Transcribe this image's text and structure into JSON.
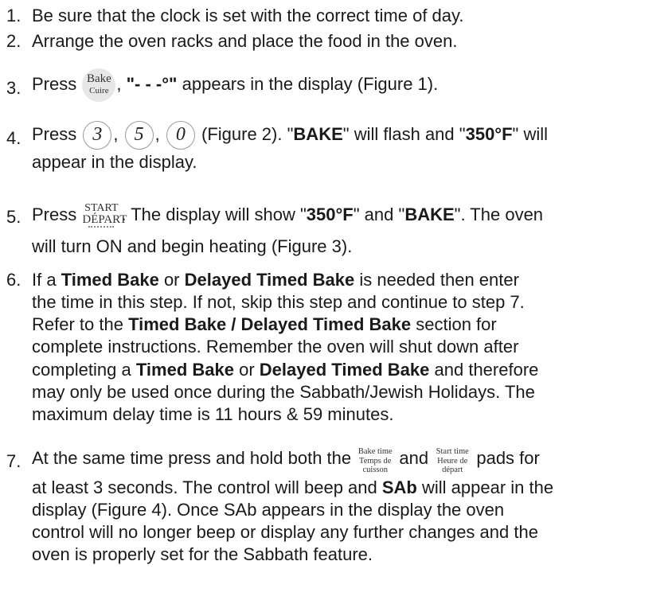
{
  "steps": [
    {
      "num": "1.",
      "text": "Be sure that the clock is set with the correct time of day."
    },
    {
      "num": "2.",
      "text": "Arrange the oven racks and place the food in the oven."
    },
    {
      "num": "3.",
      "press": "Press",
      "pad_top": "Bake",
      "pad_bottom": "Cuire",
      "comma": ",",
      "display_text": "\"- - -°\"",
      "rest": "appears in the display (Figure 1)."
    },
    {
      "num": "4.",
      "press": "Press",
      "digits": [
        "3",
        "5",
        "0"
      ],
      "comma": ",",
      "after_digits": "(Figure 2).",
      "q1": "\"",
      "bake_word": "BAKE",
      "q2": "\"",
      "flash_text": "will flash and",
      "q3": "\"",
      "temp": "350°F",
      "q4": "\"",
      "will": "will",
      "line2": "appear in the display."
    },
    {
      "num": "5.",
      "press": "Press",
      "pad_top": "START",
      "pad_bottom": "DÉPART",
      "display_text": ". The display will show",
      "q1": "\"",
      "temp": "350°F",
      "q2": "\"",
      "and_text": "and",
      "q3": "\"",
      "bake_word": "BAKE",
      "q4": "\"",
      "rest": ". The oven",
      "line2": "will turn ON and begin heating (Figure 3)."
    },
    {
      "num": "6.",
      "l1a": "If a",
      "l1b": "Timed Bake",
      "l1c": "or",
      "l1d": "Delayed Timed Bake",
      "l1e": "is needed then enter",
      "l2": "the time in this step. If not, skip this step and continue to step 7.",
      "l3a": "Refer to the",
      "l3b": "Timed Bake / Delayed Timed Bake",
      "l3c": "section for",
      "l4": "complete instructions. Remember the oven will shut down after",
      "l5a": "completing a",
      "l5b": "Timed Bake",
      "l5c": "or",
      "l5d": "Delayed Timed Bake",
      "l5e": "and therefore",
      "l6": "may only be used once during the Sabbath/Jewish Holidays. The",
      "l7": "maximum delay time is 11 hours & 59 minutes."
    },
    {
      "num": "7.",
      "l1a": "At the same time press and hold both the",
      "pad1": [
        "Bake time",
        "Temps de",
        "cuisson"
      ],
      "and_text": "and",
      "pad2": [
        "Start time",
        "Heure de",
        "départ"
      ],
      "l1b": "pads for",
      "l2a": "at least 3 seconds. The control will beep and",
      "l2b": "SAb",
      "l2c": "will appear in the",
      "l3": "display (Figure 4). Once SAb appears in the display the oven",
      "l4": "control will no longer beep or display any further changes and the",
      "l5": "oven is properly set for the Sabbath feature."
    }
  ]
}
